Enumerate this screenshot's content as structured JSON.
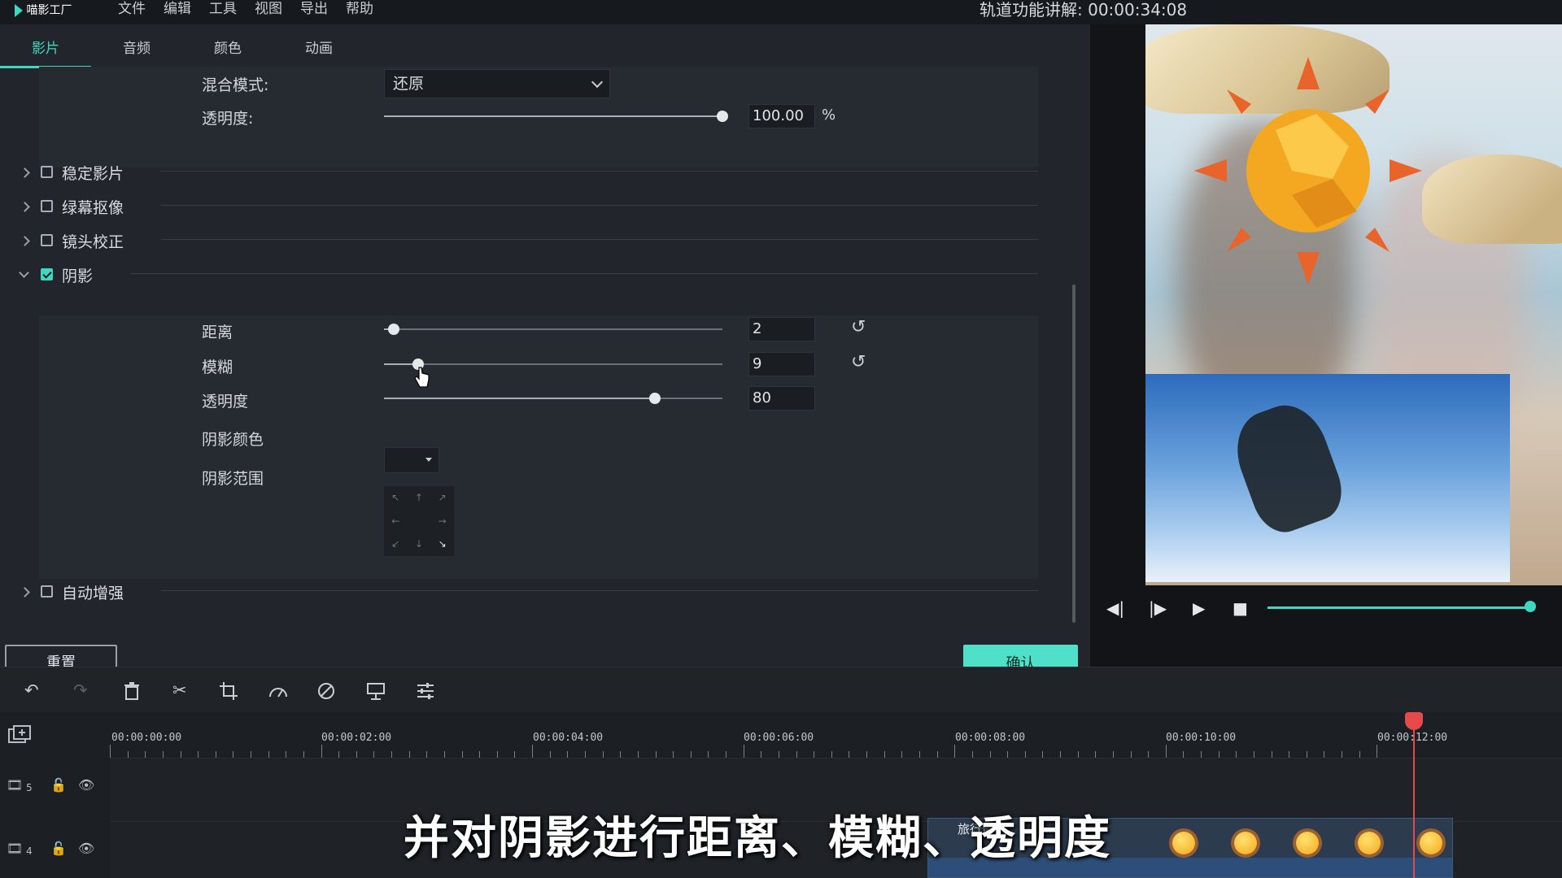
{
  "app": {
    "logo_text": "喵影工厂"
  },
  "menu": [
    "文件",
    "编辑",
    "工具",
    "视图",
    "导出",
    "帮助"
  ],
  "header": {
    "tutorial_label": "轨道功能讲解: 00:00:34:08"
  },
  "tabs": [
    {
      "label": "影片",
      "active": true
    },
    {
      "label": "音频",
      "active": false
    },
    {
      "label": "颜色",
      "active": false
    },
    {
      "label": "动画",
      "active": false
    }
  ],
  "compositing": {
    "blend_label": "混合模式:",
    "blend_value": "还原",
    "opacity_label": "透明度:",
    "opacity_value": "100.00",
    "opacity_fraction": 1.0,
    "opacity_unit": "%"
  },
  "sections": [
    {
      "label": "稳定影片",
      "checked": false,
      "expanded": false
    },
    {
      "label": "绿幕抠像",
      "checked": false,
      "expanded": false
    },
    {
      "label": "镜头校正",
      "checked": false,
      "expanded": false
    },
    {
      "label": "阴影",
      "checked": true,
      "expanded": true
    },
    {
      "label": "自动增强",
      "checked": false,
      "expanded": false
    }
  ],
  "shadow": {
    "distance_label": "距离",
    "distance_value": "2",
    "distance_fraction": 0.03,
    "blur_label": "模糊",
    "blur_value": "9",
    "blur_fraction": 0.1,
    "opacity_label": "透明度",
    "opacity_value": "80",
    "opacity_fraction": 0.8,
    "color_label": "阴影颜色",
    "range_label": "阴影范围",
    "range_selected": "bottom-right"
  },
  "buttons": {
    "reset": "重置",
    "ok": "确认"
  },
  "player": {
    "progress_fraction": 0.9
  },
  "timeline": {
    "time_labels": [
      "00:00:00:00",
      "00:00:02:00",
      "00:00:04:00",
      "00:00:06:00",
      "00:00:08:00",
      "00:00:10:00",
      "00:00:12:00"
    ],
    "tracks": [
      {
        "number": "5"
      },
      {
        "number": "4"
      }
    ],
    "clip_title": "旅行愉快"
  },
  "subtitle": "并对阴影进行距离、模糊、透明度",
  "colors": {
    "accent": "#3fd6c2",
    "playhead": "#e44a4a",
    "panel": "#22262c"
  }
}
